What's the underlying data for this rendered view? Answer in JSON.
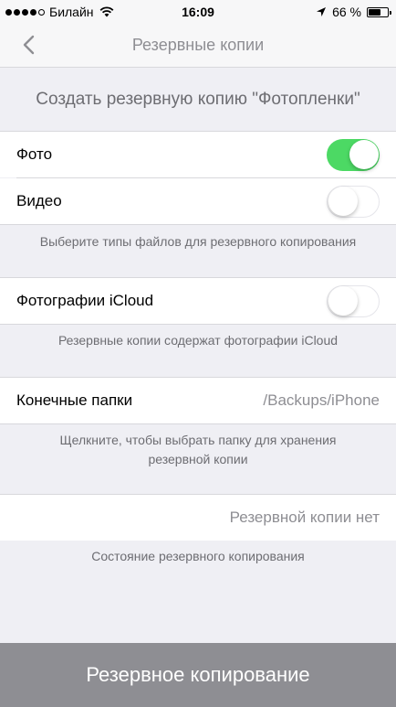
{
  "status_bar": {
    "carrier": "Билайн",
    "time": "16:09",
    "battery_percent": "66 %",
    "battery_level": 0.66,
    "signal_bars": 4
  },
  "nav": {
    "back_icon": "chevron-left-icon",
    "title": "Резервные копии"
  },
  "section_header": "Создать резервную копию \"Фотопленки\"",
  "file_types": {
    "photo_label": "Фото",
    "photo_enabled": true,
    "video_label": "Видео",
    "video_enabled": false,
    "footer": "Выберите типы файлов для резервного копирования"
  },
  "icloud": {
    "label": "Фотографии iCloud",
    "enabled": false,
    "footer": "Резервные копии содержат фотографии iCloud"
  },
  "destination": {
    "label": "Конечные папки",
    "value": "/Backups/iPhone",
    "footer": "Щелкните, чтобы выбрать папку для хранения резервной копии"
  },
  "status": {
    "value": "Резервной копии нет",
    "footer": "Состояние резервного копирования"
  },
  "action_button": "Резервное копирование",
  "colors": {
    "toggle_on": "#4cd964",
    "background": "#efeff4",
    "action_button": "#8e8e93"
  }
}
